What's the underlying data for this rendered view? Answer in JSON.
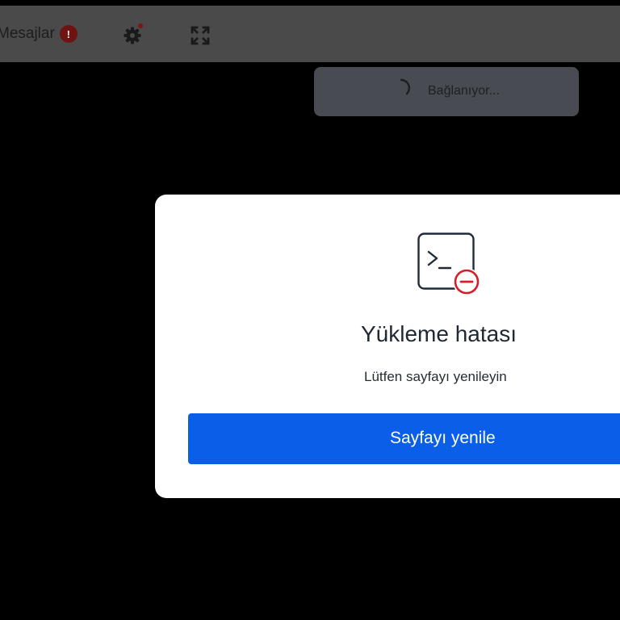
{
  "toolbar": {
    "messages_label": "Mesajlar",
    "messages_badge": "!",
    "settings_icon": "gear-icon",
    "fullscreen_icon": "expand-icon"
  },
  "toast": {
    "text": "Bağlanıyor..."
  },
  "dialog": {
    "icon": "terminal-error-icon",
    "title": "Yükleme hatası",
    "subtitle": "Lütfen sayfayı yenileyin",
    "button_label": "Sayfayı yenile"
  },
  "colors": {
    "background": "#000000",
    "toolbar": "#4a4a4a",
    "toast": "#484b51",
    "dialog": "#ffffff",
    "accent": "#0b5ee8",
    "error": "#d41e2c"
  }
}
